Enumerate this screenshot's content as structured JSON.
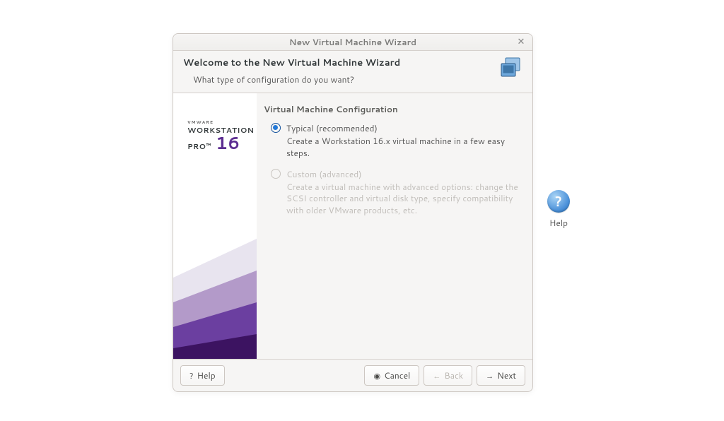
{
  "dialog": {
    "title": "New Virtual Machine Wizard",
    "header": {
      "heading": "Welcome to the New Virtual Machine Wizard",
      "subheading": "What type of configuration do you want?"
    },
    "banner": {
      "vmware": "VMWARE",
      "workstation": "WORKSTATION",
      "pro": "PRO™",
      "version": "16"
    },
    "config": {
      "section_title": "Virtual Machine Configuration",
      "options": {
        "typical": {
          "label": "Typical (recommended)",
          "desc": "Create a Workstation 16.x virtual machine in a few easy steps."
        },
        "custom": {
          "label": "Custom (advanced)",
          "desc": "Create a virtual machine with advanced options: change the SCSI controller and virtual disk type, specify compatibility with older VMware products, etc."
        }
      }
    },
    "footer": {
      "help": "Help",
      "cancel": "Cancel",
      "back": "Back",
      "next": "Next"
    }
  },
  "desktop": {
    "help_label": "Help"
  }
}
